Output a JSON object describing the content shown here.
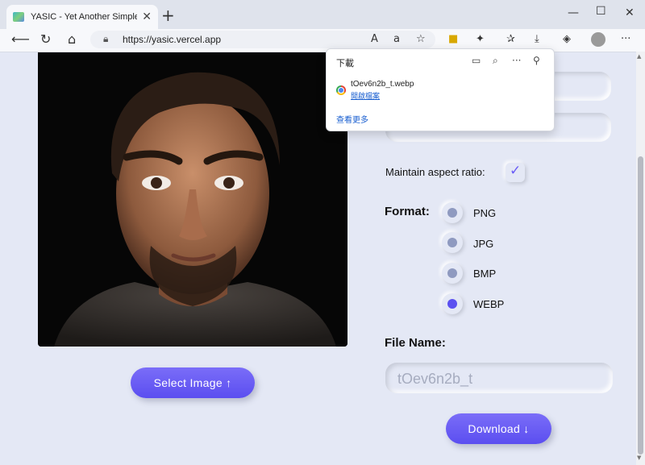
{
  "browser": {
    "tab_title": "YASIC - Yet Another Simple Imag",
    "tab_close": "✕",
    "new_tab": "+",
    "url": "https://yasic.vercel.app",
    "window": {
      "minimize": "—",
      "maximize": "☐",
      "close": "✕"
    }
  },
  "downloads": {
    "title": "下載",
    "file_name": "tOev6n2b_t.webp",
    "open_file": "開啟檔案",
    "see_more": "查看更多"
  },
  "form": {
    "aspect_label": "Maintain aspect ratio:",
    "aspect_checked": true,
    "format_label": "Format:",
    "formats": [
      "PNG",
      "JPG",
      "BMP",
      "WEBP"
    ],
    "selected_format": "WEBP",
    "file_name_label": "File Name:",
    "file_name_value": "tOev6n2b_t"
  },
  "buttons": {
    "select_image": "Select Image ↑",
    "download": "Download ↓"
  },
  "colors": {
    "accent": "#5b4ef0",
    "page_bg": "#e4e8f5"
  }
}
